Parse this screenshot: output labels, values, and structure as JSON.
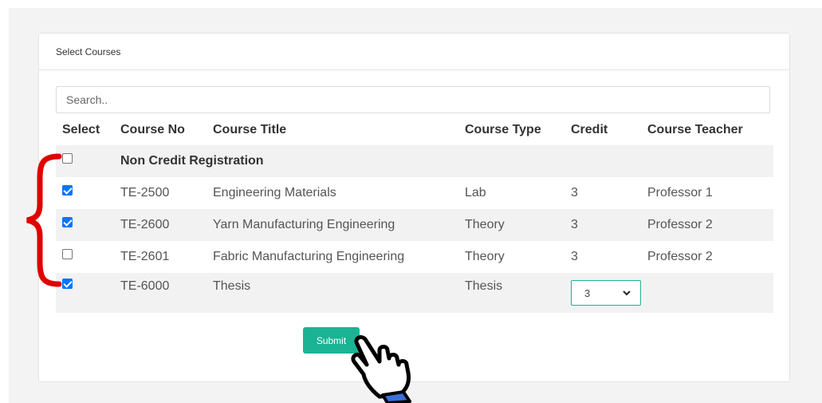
{
  "card": {
    "title": "Select Courses"
  },
  "search": {
    "placeholder": "Search.."
  },
  "table": {
    "headers": [
      "Select",
      "Course No",
      "Course Title",
      "Course Type",
      "Credit",
      "Course Teacher"
    ],
    "group_row": {
      "label": "Non Credit Registration",
      "checked": false
    },
    "rows": [
      {
        "checked": true,
        "course_no": "TE-2500",
        "title": "Engineering Materials",
        "type": "Lab",
        "credit": "3",
        "teacher": "Professor 1"
      },
      {
        "checked": true,
        "course_no": "TE-2600",
        "title": "Yarn Manufacturing Engineering",
        "type": "Theory",
        "credit": "3",
        "teacher": "Professor 2"
      },
      {
        "checked": false,
        "course_no": "TE-2601",
        "title": "Fabric Manufacturing Engineering",
        "type": "Theory",
        "credit": "3",
        "teacher": "Professor 2"
      },
      {
        "checked": true,
        "course_no": "TE-6000",
        "title": "Thesis",
        "type": "Thesis",
        "credit_select": "3",
        "teacher": ""
      }
    ]
  },
  "submit": {
    "label": "Submit"
  },
  "colors": {
    "accent": "#1ab394",
    "checkbox": "#0075ff",
    "brace": "#e00000"
  },
  "icons": [
    "checkbox-icon",
    "chevron-down-icon",
    "brace-annotation-icon",
    "pointing-hand-icon"
  ]
}
